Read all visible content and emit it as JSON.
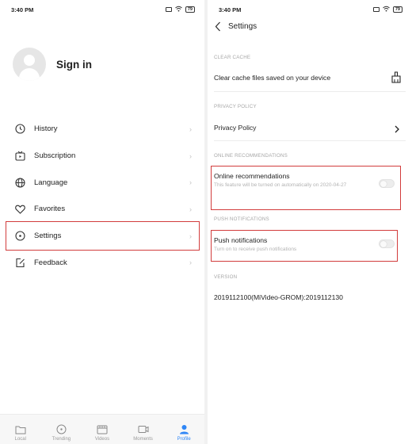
{
  "status_bar": {
    "time": "3:40 PM",
    "battery": "79"
  },
  "profile": {
    "sign_in_label": "Sign in"
  },
  "menu": {
    "items": [
      {
        "label": "History"
      },
      {
        "label": "Subscription"
      },
      {
        "label": "Language"
      },
      {
        "label": "Favorites"
      },
      {
        "label": "Settings"
      },
      {
        "label": "Feedback"
      }
    ]
  },
  "bottom_nav": {
    "items": [
      {
        "label": "Local"
      },
      {
        "label": "Trending"
      },
      {
        "label": "Videos"
      },
      {
        "label": "Moments"
      },
      {
        "label": "Profile"
      }
    ],
    "active_color": "#2f86f6"
  },
  "settings": {
    "title": "Settings",
    "clear_cache": {
      "section": "CLEAR CACHE",
      "title": "Clear cache files saved on your device"
    },
    "privacy": {
      "section": "PRIVACY POLICY",
      "title": "Privacy Policy"
    },
    "online_recommendations": {
      "section": "ONLINE RECOMMENDATIONS",
      "title": "Online recommendations",
      "subtitle": "This feature will be turned on automatically on 2020-04-27",
      "enabled": false
    },
    "push_notifications": {
      "section": "PUSH NOTIFICATIONS",
      "title": "Push notifications",
      "subtitle": "Turn on to receive push notifications",
      "enabled": false
    },
    "version": {
      "section": "VERSION",
      "value": "2019112100(MiVideo-GROM):2019112130"
    }
  },
  "highlight_color": "#d23c3c"
}
